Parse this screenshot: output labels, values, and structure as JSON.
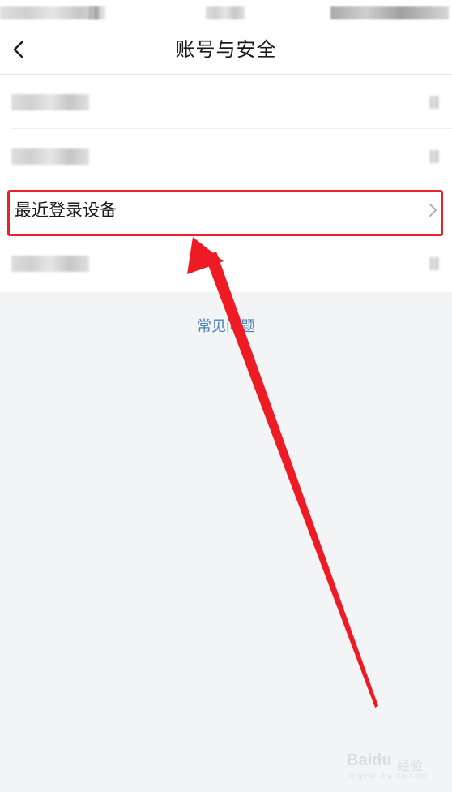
{
  "nav": {
    "title": "账号与安全"
  },
  "list": {
    "highlighted_item_label": "最近登录设备"
  },
  "footer": {
    "faq_label": "常见问题"
  },
  "watermark": {
    "brand": "Baidu",
    "sub": "经验",
    "url": "jingyan.baidu.com"
  },
  "colors": {
    "highlight": "#e8232e",
    "link": "#4d7fb8",
    "background": "#f3f4f6"
  },
  "icons": {
    "back": "chevron-left-icon",
    "row_arrow": "chevron-right-icon"
  }
}
